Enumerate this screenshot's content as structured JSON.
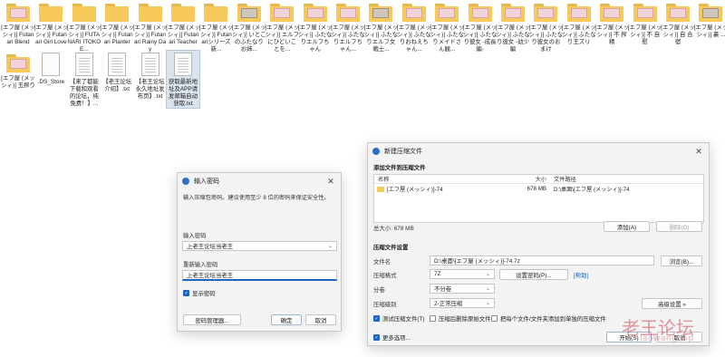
{
  "desktop": {
    "row1": [
      {
        "label": "[エフ屋 (メッシィ)] Futanari Blend",
        "kind": "folder",
        "thumb": "p"
      },
      {
        "label": "[エフ屋 (メッシィ)] Futanari Girl Love",
        "kind": "folder",
        "thumb": "n"
      },
      {
        "label": "[エフ屋 (メッシィ)] FUTANARI ITOKO E...",
        "kind": "folder",
        "thumb": "n"
      },
      {
        "label": "[エフ屋 (メッシィ)] Futanari Planter",
        "kind": "folder",
        "thumb": "n"
      },
      {
        "label": "[エフ屋 (メッシィ)] Futanari Rainy Day",
        "kind": "folder",
        "thumb": "n"
      },
      {
        "label": "[エフ屋 (メッシィ)] Futanari Teacher",
        "kind": "folder",
        "thumb": "n"
      },
      {
        "label": "[エフ屋 (メッシィ)] Futanariシリーズ新...",
        "kind": "folder",
        "thumb": "n"
      },
      {
        "label": "[エフ屋 (メッシィ)] いとこのふたなりお姉...",
        "kind": "folder",
        "thumb": "d"
      },
      {
        "label": "[エフ屋 (メッシィ)] エルフにひどいことを...",
        "kind": "folder",
        "thumb": "p"
      },
      {
        "label": "[エフ屋 (メッシィ)] ふたなりエルフちゃん",
        "kind": "folder",
        "thumb": "p"
      },
      {
        "label": "[エフ屋 (メッシィ)] ふたなりエルフちゃん...",
        "kind": "folder",
        "thumb": "p"
      },
      {
        "label": "[エフ屋 (メッシィ)] ふたなりエルフ女戦士...",
        "kind": "folder",
        "thumb": "d"
      },
      {
        "label": "[エフ屋 (メッシィ)] ふたなりおねえちゃん...",
        "kind": "folder",
        "thumb": "p"
      },
      {
        "label": "[エフ屋 (メッシィ)] ふたなりメイドさん観...",
        "kind": "folder",
        "thumb": "p"
      },
      {
        "label": "[エフ屋 (メッシィ)] ふたなり彼女 -成長編-",
        "kind": "folder",
        "thumb": "p"
      },
      {
        "label": "[エフ屋 (メッシィ)] ふたなり彼女 -幼少編",
        "kind": "folder",
        "thumb": "p"
      },
      {
        "label": "[エフ屋 (メッシィ)] ふたなり彼女のおまけ",
        "kind": "folder",
        "thumb": "p"
      },
      {
        "label": "[エフ屋 (メッシィ)] ふたなり王ズリ",
        "kind": "folder",
        "thumb": "p"
      },
      {
        "label": "[エフ屋 (メッシィ)] 不 搾精",
        "kind": "folder",
        "thumb": "p"
      },
      {
        "label": "[エフ屋 (メッシィ)] 不 自慰",
        "kind": "folder",
        "thumb": "p"
      },
      {
        "label": "[エフ屋 (メッシィ)] 自 合宿",
        "kind": "folder",
        "thumb": "p"
      },
      {
        "label": "[エフ屋 (メッシィ)] 裏 ...",
        "kind": "folder",
        "thumb": "d"
      }
    ],
    "row2": [
      {
        "label": "[エフ屋 (メッシィ)] 玉搾り",
        "kind": "folder",
        "thumb": "p"
      },
      {
        "label": ".DS_Store",
        "kind": "file-blank"
      },
      {
        "label": "【来了都能下载和观看的论坛，纯免费！】...",
        "kind": "file"
      },
      {
        "label": "【老王论坛介绍】.txt",
        "kind": "file"
      },
      {
        "label": "【老王论坛永久地址发布页】.txt",
        "kind": "file"
      },
      {
        "label": "获取最新地址及APP请发邮箱自动获取.txt",
        "kind": "file",
        "selected": true
      }
    ]
  },
  "password_dialog": {
    "title": "输入密码",
    "close_glyph": "✕",
    "instruction": "输入压缩包密码。建议使用至少 8 位的密码来保证安全性。",
    "enter_label": "输入密码",
    "enter_value": "上老王论坛当老王",
    "reenter_label": "重新输入密码",
    "reenter_value": "上老王论坛当老王",
    "show_password_label": "显示密码",
    "manager_button": "密码管理器...",
    "ok_button": "确定",
    "cancel_button": "取消"
  },
  "archive_dialog": {
    "title": "新建压缩文件",
    "close_glyph": "✕",
    "section_add": "添加文件到压缩文件",
    "col_name": "名称",
    "col_size": "大小",
    "col_path": "文件路径",
    "row_name": "[エフ屋 (メッシィ)]-74",
    "row_size": "678 MB",
    "row_path": "D:\\桌面\\[エフ屋 (メッシィ)]-74",
    "total_size": "总大小: 678 MB",
    "add_button": "添加(A)",
    "remove_button": "删除(D)",
    "section_settings": "压缩文件设置",
    "filename_label": "文件名",
    "filename_value": "D:\\桌面\\[エフ屋 (メッシィ)]-74.7z",
    "browse_button": "浏览(B)...",
    "format_label": "压缩格式",
    "format_value": "7Z",
    "set_password_button": "设置密码(P)...",
    "help_link": "[帮助]",
    "volume_label": "分卷",
    "volume_value": "不分卷",
    "level_label": "压缩级别",
    "level_value": "2-正常压缩",
    "advanced_button": "高级设置 »",
    "test_label": "测试压缩文件(T)",
    "delete_label": "压缩后删除原始文件",
    "each_label": "把每个文件/文件夹添加到单独的压缩文件",
    "more_label": "更多选项...",
    "start_button": "开始(S)",
    "cancel_button": "取消"
  },
  "watermark": {
    "text": "老王论坛",
    "sub": "laowang.vip"
  },
  "colors": {
    "accent": "#1f63c6",
    "folder": "#f6c95a"
  }
}
